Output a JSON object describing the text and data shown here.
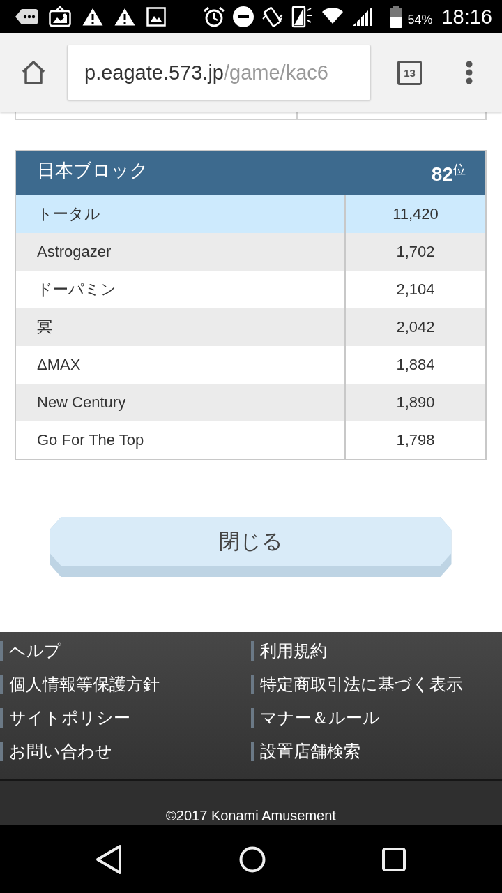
{
  "status_bar": {
    "battery": "54%",
    "time": "18:16"
  },
  "browser": {
    "url": {
      "host": "p.eagate.573.jp",
      "path": "/game/kac6"
    },
    "tab_count": "13"
  },
  "ranking": {
    "title": "日本ブロック",
    "rank": "**82**$^{位}$",
    "rows": [
      {
        "name": "トータル",
        "score": "11,420",
        "highlighted": true
      },
      {
        "name": "Astrogazer",
        "score": "1,702",
        "highlighted": false
      },
      {
        "name": "ドーパミン",
        "score": "2,104",
        "highlighted": false
      },
      {
        "name": "冥",
        "score": "2,042",
        "highlighted": false
      },
      {
        "name": "ΔMAX",
        "score": "1,884",
        "highlighted": false
      },
      {
        "name": "New Century",
        "score": "1,890",
        "highlighted": false
      },
      {
        "name": "Go For The Top",
        "score": "1,798",
        "highlighted": false
      }
    ]
  },
  "close_button": "閉じる",
  "footer": {
    "links": [
      "ヘルプ",
      "利用規約",
      "個人情報等保護方針",
      "特定商取引法に基づく表示",
      "サイトポリシー",
      "マナー＆ルール",
      "お問い合わせ",
      "設置店舗検索"
    ],
    "copyright": "©2017 Konami Amusement"
  }
}
